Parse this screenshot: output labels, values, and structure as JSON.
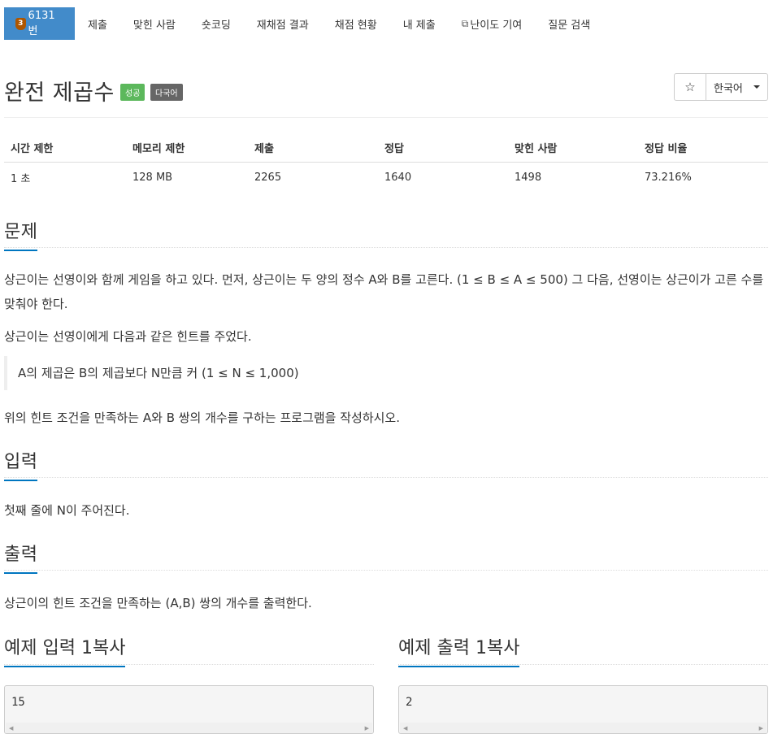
{
  "nav": {
    "tier": "3",
    "problem_number": "6131번",
    "items": [
      "제출",
      "맞힌 사람",
      "숏코딩",
      "재채점 결과",
      "채점 현황",
      "내 제출",
      "난이도 기여",
      "질문 검색"
    ]
  },
  "problem": {
    "title": "완전 제곱수",
    "badge_success": "성공",
    "badge_multilang": "다국어",
    "star": "☆",
    "language": "한국어"
  },
  "info": {
    "headers": [
      "시간 제한",
      "메모리 제한",
      "제출",
      "정답",
      "맞힌 사람",
      "정답 비율"
    ],
    "values": [
      "1 초",
      "128 MB",
      "2265",
      "1640",
      "1498",
      "73.216%"
    ]
  },
  "sections": {
    "problem_title": "문제",
    "problem_p1": "상근이는 선영이와 함께 게임을 하고 있다. 먼저, 상근이는 두 양의 정수 A와 B를 고른다. (1 ≤ B ≤ A ≤ 500) 그 다음, 선영이는 상근이가 고른 수를 맞춰야 한다.",
    "problem_p2": "상근이는 선영이에게 다음과 같은 힌트를 주었다.",
    "problem_quote": "A의 제곱은 B의 제곱보다 N만큼 커 (1 ≤ N ≤ 1,000)",
    "problem_p3": "위의 힌트 조건을 만족하는 A와 B 쌍의 개수를 구하는 프로그램을 작성하시오.",
    "input_title": "입력",
    "input_text": "첫째 줄에 N이 주어진다.",
    "output_title": "출력",
    "output_text": "상근이의 힌트 조건을 만족하는 (A,B) 쌍의 개수를 출력한다."
  },
  "samples": {
    "input_title": "예제 입력 1",
    "output_title": "예제 출력 1",
    "copy_label": "복사",
    "input_value": "15",
    "output_value": "2"
  },
  "colors": {
    "accent": "#428bca",
    "link": "#0076c0",
    "success": "#5cb85c",
    "muted_badge": "#666666",
    "tier_bronze": "#ad5600"
  }
}
